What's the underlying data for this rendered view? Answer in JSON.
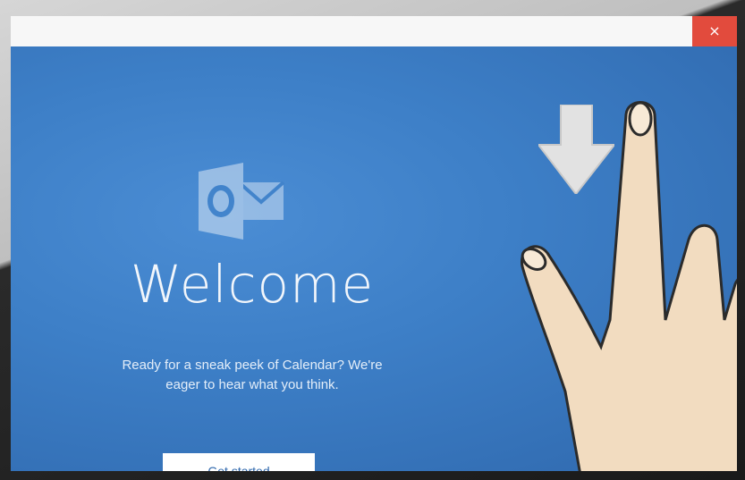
{
  "window": {
    "close_label": "×"
  },
  "welcome": {
    "title": "Welcome",
    "subtitle_line1": "Ready for a sneak peek of Calendar? We're",
    "subtitle_line2": "eager to hear what you think.",
    "button_label": "Get started"
  },
  "colors": {
    "background_blue": "#3d7fc7",
    "close_red": "#e24b3d",
    "title_bar": "#f7f7f7"
  },
  "icons": {
    "app_logo": "outlook-icon",
    "gesture_arrow": "arrow-down-icon",
    "gesture_hand": "hand-icon"
  }
}
